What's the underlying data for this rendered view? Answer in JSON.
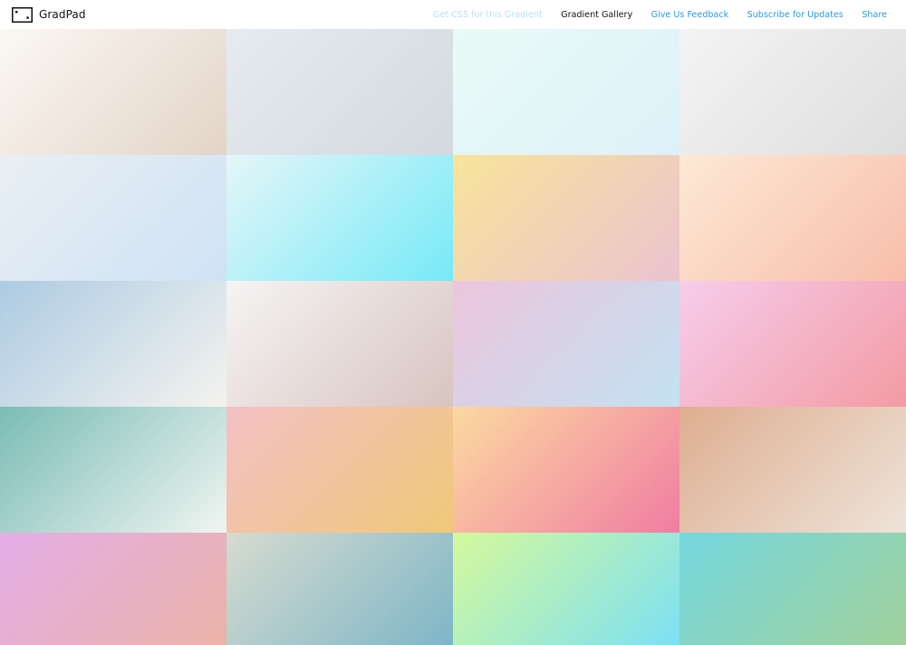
{
  "app": {
    "name": "GradPad",
    "logo_icon": "window-icon"
  },
  "nav": {
    "items": [
      {
        "label": "Get CSS for this Gradient",
        "state": "disabled"
      },
      {
        "label": "Gradient Gallery",
        "state": "active"
      },
      {
        "label": "Give Us Feedback",
        "state": "link"
      },
      {
        "label": "Subscribe for Updates",
        "state": "link"
      },
      {
        "label": "Share",
        "state": "link"
      }
    ]
  },
  "colors": {
    "link": "#2a9ae6",
    "link_disabled": "#b9dff7",
    "active": "#111111",
    "background": "#ffffff"
  },
  "gallery": {
    "columns": 4,
    "gradients": [
      {
        "from": "#fbf8f4",
        "to": "#e3d4c7"
      },
      {
        "from": "#e6ebef",
        "to": "#d4d9df"
      },
      {
        "from": "#e9fbf6",
        "to": "#dcf1f9"
      },
      {
        "from": "#f4f4f4",
        "to": "#dedede"
      },
      {
        "from": "#e9eff4",
        "to": "#cfe2f5"
      },
      {
        "from": "#e5f6f8",
        "to": "#76eaf7"
      },
      {
        "from": "#f8e49a",
        "to": "#ebc3d0"
      },
      {
        "from": "#fde9d6",
        "to": "#f7beaa"
      },
      {
        "from": "#adcbe2",
        "to": "#f4f3ef"
      },
      {
        "from": "#f5f4f4",
        "to": "#d8c4c0"
      },
      {
        "from": "#ecc5dd",
        "to": "#c2e2f1"
      },
      {
        "from": "#f6cdec",
        "to": "#f39ba3"
      },
      {
        "from": "#7bbcb6",
        "to": "#f0f5f1"
      },
      {
        "from": "#f3c0c4",
        "to": "#f1c878"
      },
      {
        "from": "#fcd9a1",
        "to": "#f07da2"
      },
      {
        "from": "#deae90",
        "to": "#eee3d9"
      },
      {
        "from": "#e4aee8",
        "to": "#ebb2a6"
      },
      {
        "from": "#d6dbcf",
        "to": "#7eb6c7"
      },
      {
        "from": "#d5f99c",
        "to": "#7ce0f4"
      },
      {
        "from": "#74d7de",
        "to": "#a1d19c"
      }
    ]
  }
}
